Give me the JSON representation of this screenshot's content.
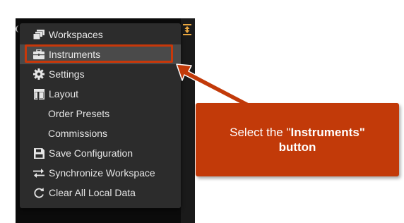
{
  "menu": {
    "items": [
      {
        "label": "Workspaces",
        "icon": "workspaces-icon"
      },
      {
        "label": "Instruments",
        "icon": "briefcase-icon"
      },
      {
        "label": "Settings",
        "icon": "gear-icon"
      },
      {
        "label": "Layout",
        "icon": "layout-icon"
      },
      {
        "label": "Order Presets",
        "icon": ""
      },
      {
        "label": "Commissions",
        "icon": ""
      },
      {
        "label": "Save Configuration",
        "icon": "save-icon"
      },
      {
        "label": "Synchronize Workspace",
        "icon": "sync-arrows-icon"
      },
      {
        "label": "Clear All Local Data",
        "icon": "refresh-icon"
      }
    ],
    "selected_index": 1
  },
  "callout": {
    "prefix": "Select the \"",
    "bold": "Instruments\"",
    "line2": "button"
  },
  "colors": {
    "accent": "#c8380a",
    "callout_bg": "#c23a09",
    "menu_bg": "#2c2c2c",
    "menu_text": "#e6e6e6",
    "selected_bg": "#4a4a4a",
    "resize_icon": "#e8a640"
  }
}
